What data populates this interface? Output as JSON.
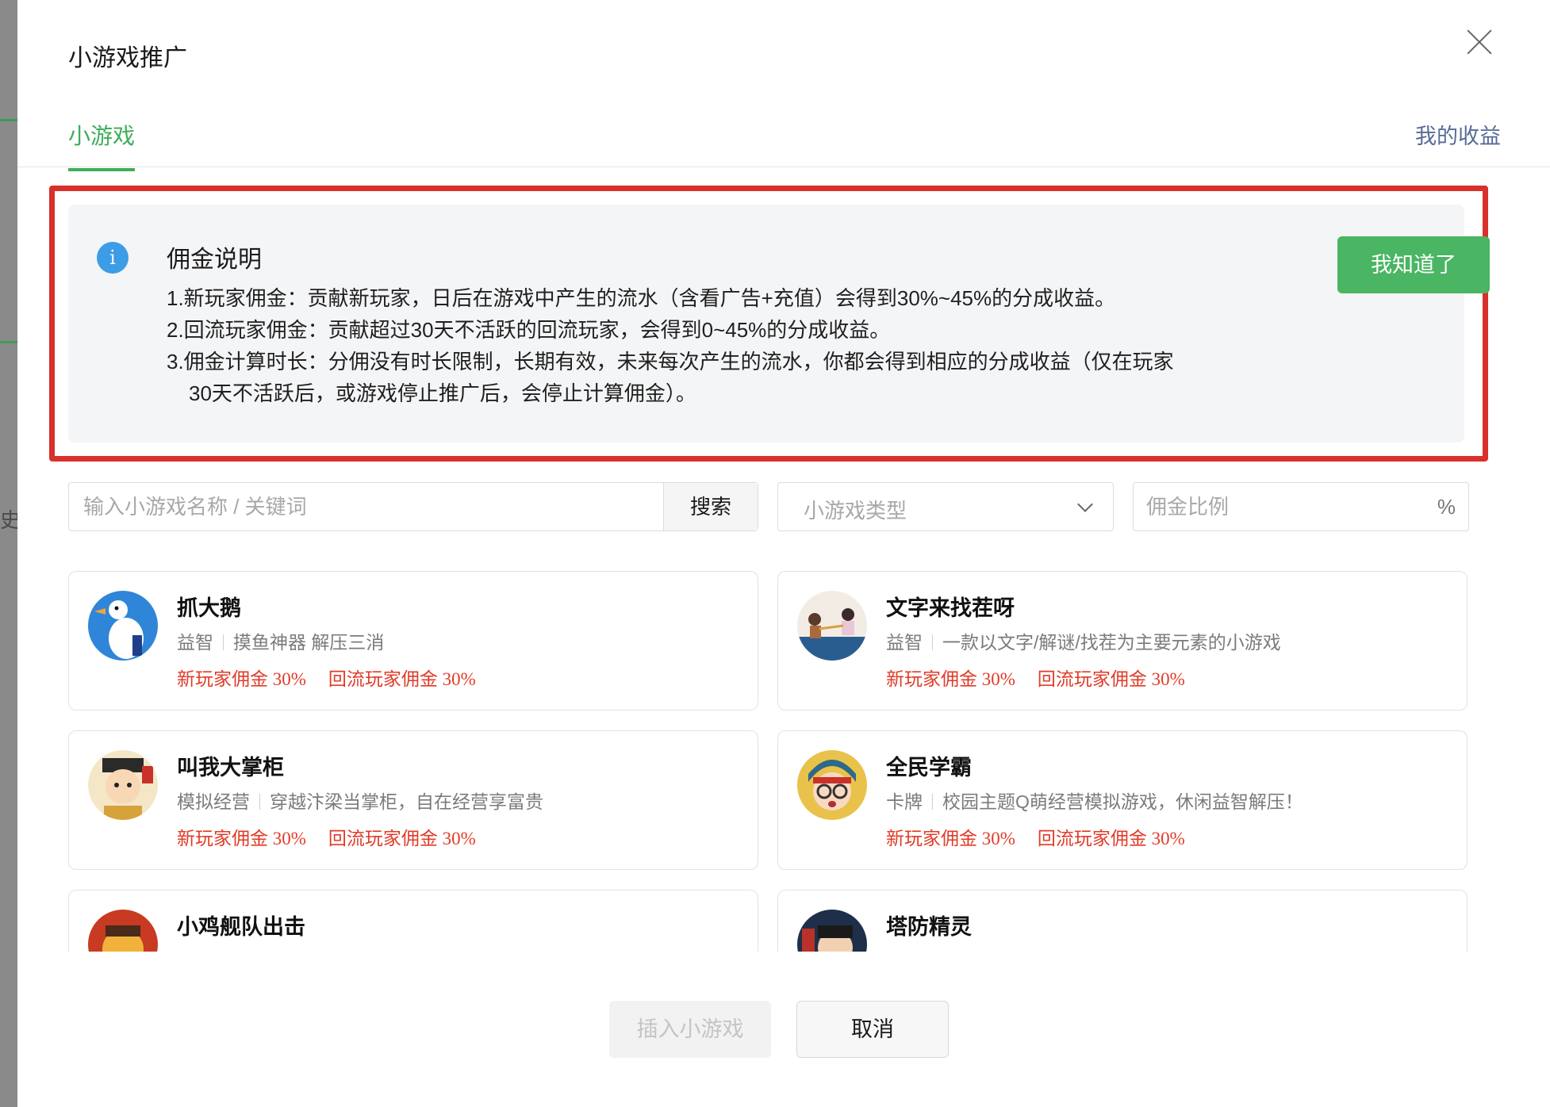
{
  "backdrop": {
    "peek_text": "史"
  },
  "dialog": {
    "title": "小游戏推广",
    "tabs": {
      "active": "小游戏",
      "earnings": "我的收益"
    }
  },
  "notice": {
    "title": "佣金说明",
    "lines": [
      "1.新玩家佣金：贡献新玩家，日后在游戏中产生的流水（含看广告+充值）会得到30%~45%的分成收益。",
      "2.回流玩家佣金：贡献超过30天不活跃的回流玩家，会得到0~45%的分成收益。",
      "3.佣金计算时长：分佣没有时长限制，长期有效，未来每次产生的流水，你都会得到相应的分成收益（仅在玩家",
      "30天不活跃后，或游戏停止推广后，会停止计算佣金）。"
    ],
    "ack_label": "我知道了",
    "highlight_color": "#d8302b"
  },
  "filters": {
    "search_placeholder": "输入小游戏名称 / 关键词",
    "search_button": "搜索",
    "type_placeholder": "小游戏类型",
    "ratio_placeholder": "佣金比例",
    "ratio_unit": "%"
  },
  "games": [
    {
      "name": "抓大鹅",
      "category": "益智",
      "desc": "摸鱼神器 解压三消",
      "new_player": "新玩家佣金 30%",
      "returning": "回流玩家佣金 30%",
      "icon": "goose-avatar"
    },
    {
      "name": "文字来找茬呀",
      "category": "益智",
      "desc": "一款以文字/解谜/找茬为主要元素的小游戏",
      "new_player": "新玩家佣金 30%",
      "returning": "回流玩家佣金 30%",
      "icon": "tug-of-war-avatar"
    },
    {
      "name": "叫我大掌柜",
      "category": "模拟经营",
      "desc": "穿越汴梁当掌柜，自在经营享富贵",
      "new_player": "新玩家佣金 30%",
      "returning": "回流玩家佣金 30%",
      "icon": "shopkeeper-avatar"
    },
    {
      "name": "全民学霸",
      "category": "卡牌",
      "desc": "校园主题Q萌经营模拟游戏，休闲益智解压！",
      "new_player": "新玩家佣金 30%",
      "returning": "回流玩家佣金 30%",
      "icon": "student-avatar"
    },
    {
      "name": "小鸡舰队出击",
      "category": "",
      "desc": "",
      "new_player": "",
      "returning": "",
      "icon": "chicken-fleet-avatar"
    },
    {
      "name": "塔防精灵",
      "category": "",
      "desc": "",
      "new_player": "",
      "returning": "",
      "icon": "tower-defense-avatar"
    }
  ],
  "footer": {
    "insert_label": "插入小游戏",
    "cancel_label": "取消"
  },
  "colors": {
    "accent": "#3cae5a",
    "link": "#576b95",
    "commission": "#e03b28",
    "primary_button": "#4ab562"
  }
}
